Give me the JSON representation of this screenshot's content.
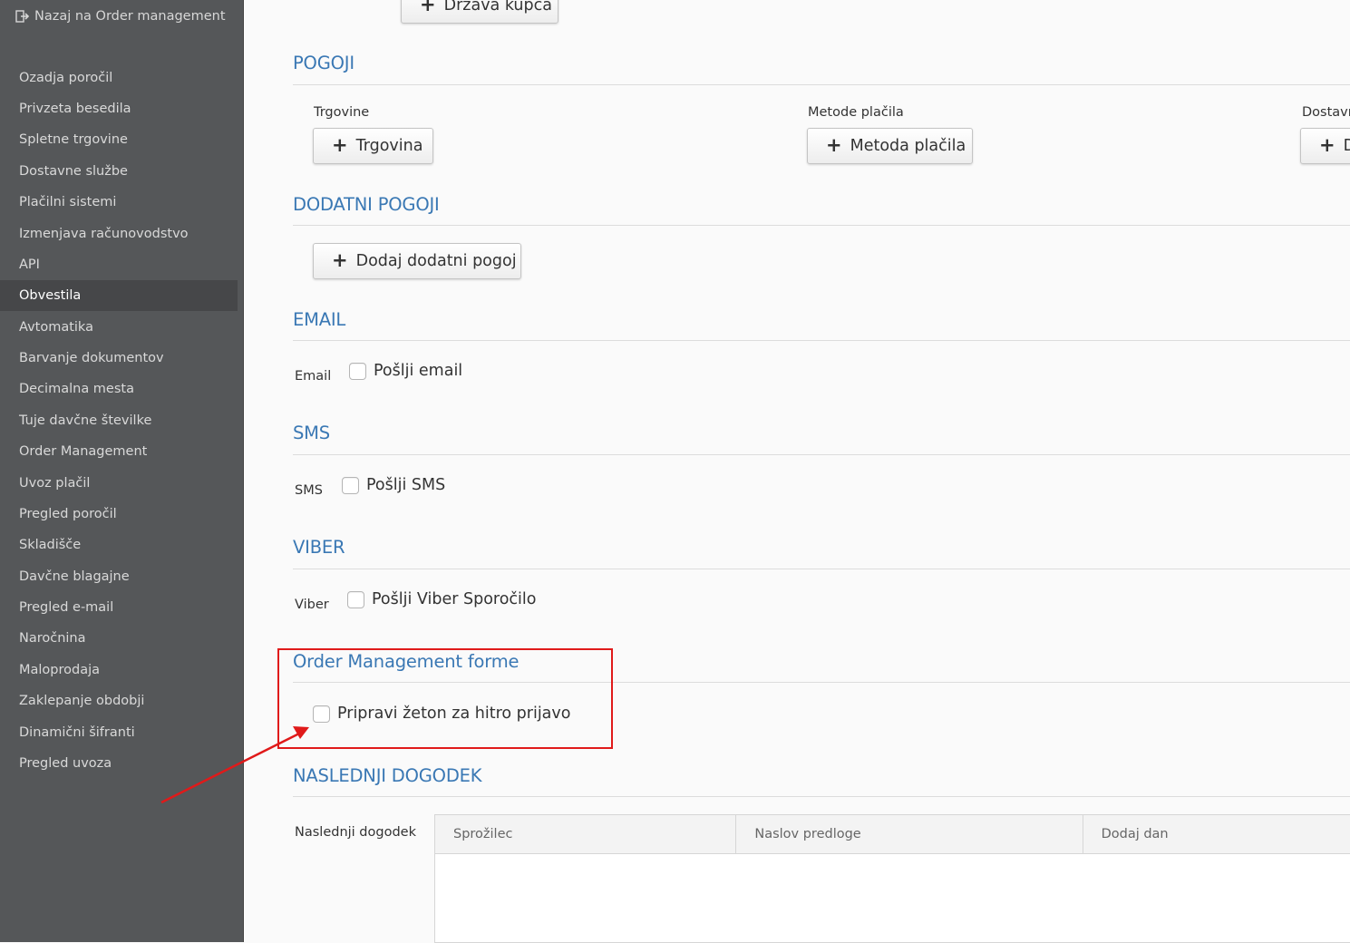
{
  "sidebar": {
    "back_label": "Nazaj na Order management",
    "active_index": 7,
    "items": [
      {
        "label": "Ozadja poročil"
      },
      {
        "label": "Privzeta besedila"
      },
      {
        "label": "Spletne trgovine"
      },
      {
        "label": "Dostavne službe"
      },
      {
        "label": "Plačilni sistemi"
      },
      {
        "label": "Izmenjava računovodstvo"
      },
      {
        "label": "API"
      },
      {
        "label": "Obvestila"
      },
      {
        "label": "Avtomatika"
      },
      {
        "label": "Barvanje dokumentov"
      },
      {
        "label": "Decimalna mesta"
      },
      {
        "label": "Tuje davčne številke"
      },
      {
        "label": "Order Management"
      },
      {
        "label": "Uvoz plačil"
      },
      {
        "label": "Pregled poročil"
      },
      {
        "label": "Skladišče"
      },
      {
        "label": "Davčne blagajne"
      },
      {
        "label": "Pregled e-mail"
      },
      {
        "label": "Naročnina"
      },
      {
        "label": "Maloprodaja"
      },
      {
        "label": "Zaklepanje obdobji"
      },
      {
        "label": "Dinamični šifranti"
      },
      {
        "label": "Pregled uvoza"
      }
    ]
  },
  "top_button": {
    "label": "Država kupca"
  },
  "pogoji": {
    "title": "POGOJI",
    "trgovine": {
      "label": "Trgovine",
      "button": "Trgovina"
    },
    "metode": {
      "label": "Metode plačila",
      "button": "Metoda plačila"
    },
    "dostava": {
      "label": "Dostavne",
      "button": "D"
    }
  },
  "dodatni": {
    "title": "DODATNI POGOJI",
    "button": "Dodaj dodatni pogoj"
  },
  "email": {
    "title": "EMAIL",
    "label": "Email",
    "checkbox": "Pošlji email"
  },
  "sms": {
    "title": "SMS",
    "label": "SMS",
    "checkbox": "Pošlji SMS"
  },
  "viber": {
    "title": "VIBER",
    "label": "Viber",
    "checkbox": "Pošlji Viber Sporočilo"
  },
  "om_forms": {
    "title": "Order Management forme",
    "checkbox": "Pripravi žeton za hitro prijavo"
  },
  "next_event": {
    "title": "NASLEDNJI DOGODEK",
    "label": "Naslednji dogodek",
    "columns": [
      "Sprožilec",
      "Naslov predloge",
      "Dodaj dan"
    ]
  },
  "colors": {
    "accent": "#3a78b4",
    "sidebar": "#555759",
    "annotation": "#e01a1a"
  }
}
